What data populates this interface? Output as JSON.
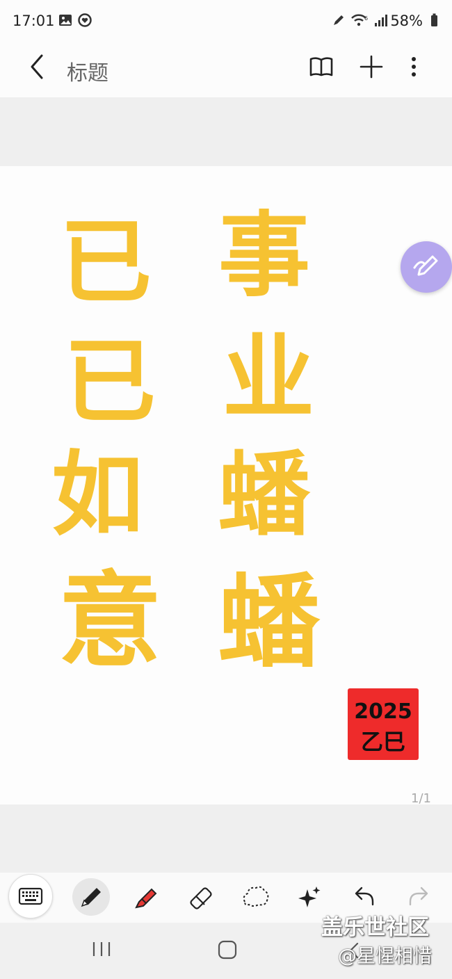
{
  "status": {
    "time": "17:01",
    "battery": "58%"
  },
  "appbar": {
    "title": "标题"
  },
  "canvas": {
    "left_column": [
      "已",
      "已",
      "如",
      "意"
    ],
    "right_column": [
      "事",
      "业",
      "蟠",
      "蟠"
    ],
    "stamp_line1": "2025",
    "stamp_line2": "乙巳",
    "page_indicator": "1/1"
  },
  "watermark": {
    "line1": "盖乐世社区",
    "line2": "@星惺相惜"
  },
  "colors": {
    "ink": "#f6c232",
    "stamp": "#ee2b2b",
    "fab": "#b5a7ee"
  },
  "icons": [
    "back-icon",
    "book-icon",
    "plus-icon",
    "more-icon",
    "pen-fab-icon",
    "keyboard-icon",
    "pen-icon",
    "highlighter-icon",
    "eraser-icon",
    "lasso-icon",
    "sparkle-icon",
    "undo-icon",
    "redo-icon"
  ]
}
